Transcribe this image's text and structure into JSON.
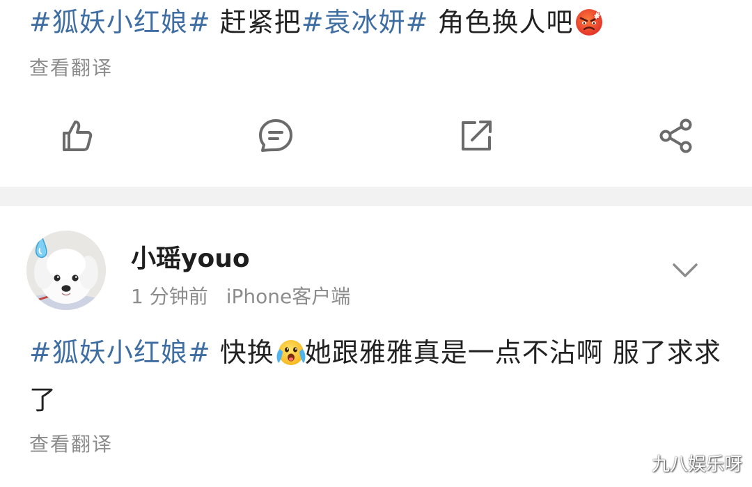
{
  "post1": {
    "topic_1": "#狐妖小红娘#",
    "text_1": " 赶紧把",
    "topic_2": "#袁冰妍#",
    "text_2": " 角色换人吧",
    "emoji": "angry-face-emoji",
    "translate": "查看翻译"
  },
  "actions": {
    "like_icon": "thumbs-up-icon",
    "comment_icon": "comment-icon",
    "repost_icon": "repost-icon",
    "share_icon": "share-icon"
  },
  "post2": {
    "username": "小瑶youo",
    "time": "1 分钟前",
    "source": "iPhone客户端",
    "topic_1": "#狐妖小红娘#",
    "text_1": " 快换",
    "emoji": "crying-laughing-emoji",
    "text_2": "她跟雅雅真是一点不沾啊 服了求求了",
    "translate": "查看翻译",
    "avatar": "white-puppy-avatar"
  },
  "watermark": "九八娱乐呀",
  "colors": {
    "topic": "#3f6ea3",
    "text": "#222222",
    "muted": "#8c8c8c",
    "icon": "#6b6b6b",
    "divider": "#f2f2f2"
  }
}
